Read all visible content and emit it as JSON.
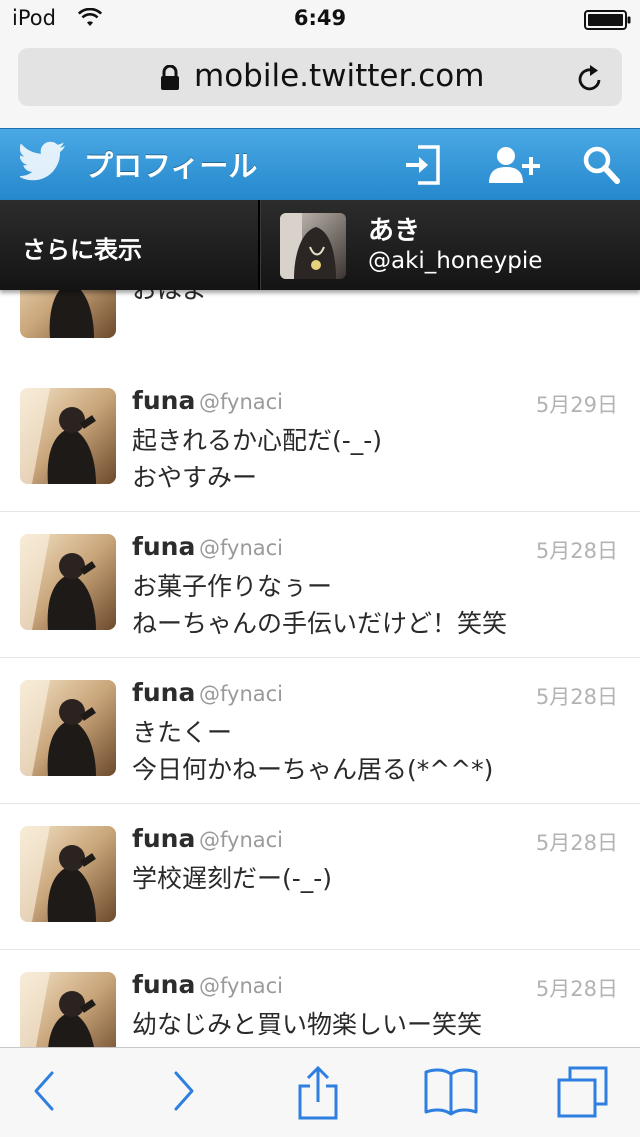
{
  "status_bar": {
    "carrier": "iPod",
    "time": "6:49"
  },
  "browser": {
    "url": "mobile.twitter.com"
  },
  "twitter_header": {
    "title": "プロフィール"
  },
  "profile_bar": {
    "more_label": "さらに表示",
    "name": "あき",
    "handle": "@aki_honeypie"
  },
  "partial_tweet": {
    "text": "おはよー"
  },
  "tweets": [
    {
      "name": "funa",
      "handle": "@fynaci",
      "date": "5月29日",
      "text": "起きれるか心配だ(-_-)\nおやすみー"
    },
    {
      "name": "funa",
      "handle": "@fynaci",
      "date": "5月28日",
      "text": "お菓子作りなぅー\nねーちゃんの手伝いだけど！笑笑"
    },
    {
      "name": "funa",
      "handle": "@fynaci",
      "date": "5月28日",
      "text": "きたくー\n今日何かねーちゃん居る(*^^*)"
    },
    {
      "name": "funa",
      "handle": "@fynaci",
      "date": "5月28日",
      "text": "学校遅刻だー(-_-)"
    },
    {
      "name": "funa",
      "handle": "@fynaci",
      "date": "5月28日",
      "text": "幼なじみと買い物楽しいー笑笑"
    }
  ],
  "toolbar": {
    "icons": [
      "back-icon",
      "forward-icon",
      "share-icon",
      "bookmarks-icon",
      "tabs-icon"
    ]
  },
  "colors": {
    "twitter_blue": "#2f93d6",
    "ios_tint": "#1a73e8",
    "profile_bar": "#1e1e1e"
  }
}
